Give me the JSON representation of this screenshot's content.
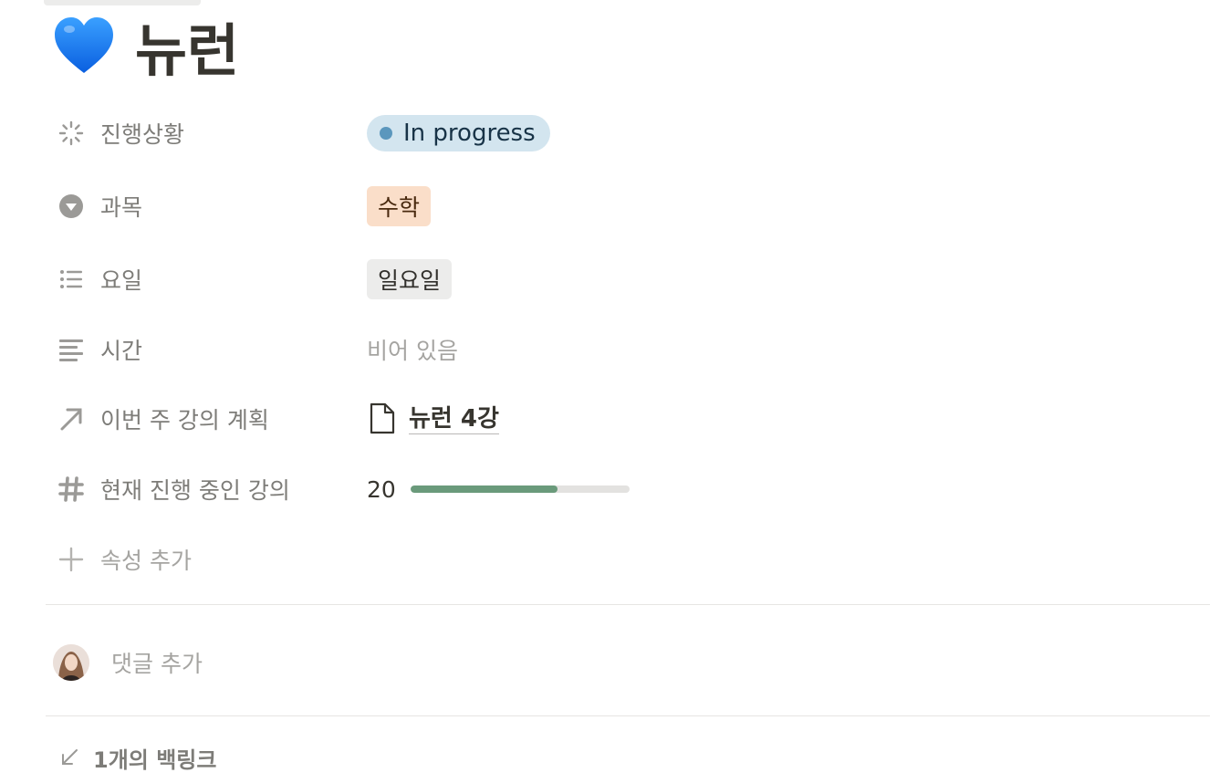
{
  "page": {
    "icon": "blue-heart-icon",
    "title": "뉴런"
  },
  "properties": {
    "status": {
      "icon": "loading-spinner-icon",
      "label": "진행상황",
      "value": "In progress",
      "dot_color": "#5b97bd"
    },
    "subject": {
      "icon": "select-triangle-icon",
      "label": "과목",
      "value": "수학"
    },
    "day": {
      "icon": "list-icon",
      "label": "요일",
      "value": "일요일"
    },
    "time": {
      "icon": "text-lines-icon",
      "label": "시간",
      "value": "비어 있음"
    },
    "plan": {
      "icon": "relation-arrow-icon",
      "label": "이번 주 강의 계획",
      "value": "뉴런 4강",
      "value_icon": "document-icon"
    },
    "current": {
      "icon": "hash-icon",
      "label": "현재 진행 중인 강의",
      "value": "20",
      "progress": 0.67,
      "bar_color": "#6a9a7b"
    },
    "add": {
      "icon": "plus-icon",
      "label": "속성 추가"
    }
  },
  "comments": {
    "placeholder": "댓글 추가"
  },
  "backlinks": {
    "icon": "arrow-down-left-icon",
    "label": "1개의 백링크"
  },
  "colors": {
    "status_bg": "#d3e5ef",
    "subject_bg": "#fadec9",
    "day_bg": "#ececeb"
  }
}
